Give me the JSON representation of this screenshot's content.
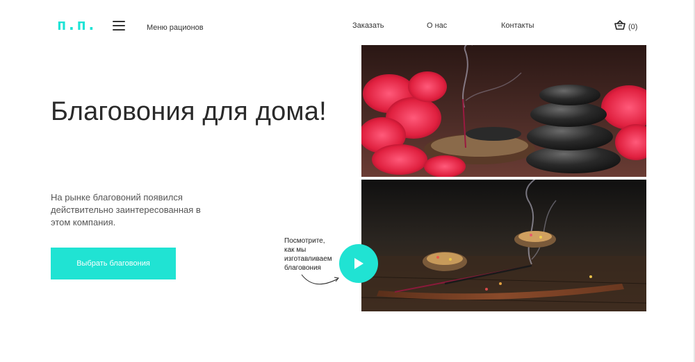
{
  "header": {
    "logo": "п.п.",
    "menu_label": "Меню рационов",
    "nav": {
      "order": "Заказать",
      "about": "О нас",
      "contacts": "Контакты"
    },
    "cart_count": "(0)"
  },
  "hero": {
    "title": "Благовония для дома!",
    "description": "На рынке благовоний появился действительно заинтересованная в этом компания.",
    "cta_label": "Выбрать благовония"
  },
  "video": {
    "caption_lines": [
      "Посмотрите,",
      "как мы",
      "изготавливаем",
      "благовония"
    ]
  },
  "colors": {
    "accent": "#20e3d3",
    "text": "#333333"
  },
  "icons": {
    "menu": "hamburger-icon",
    "cart": "basket-icon",
    "play": "play-icon"
  }
}
